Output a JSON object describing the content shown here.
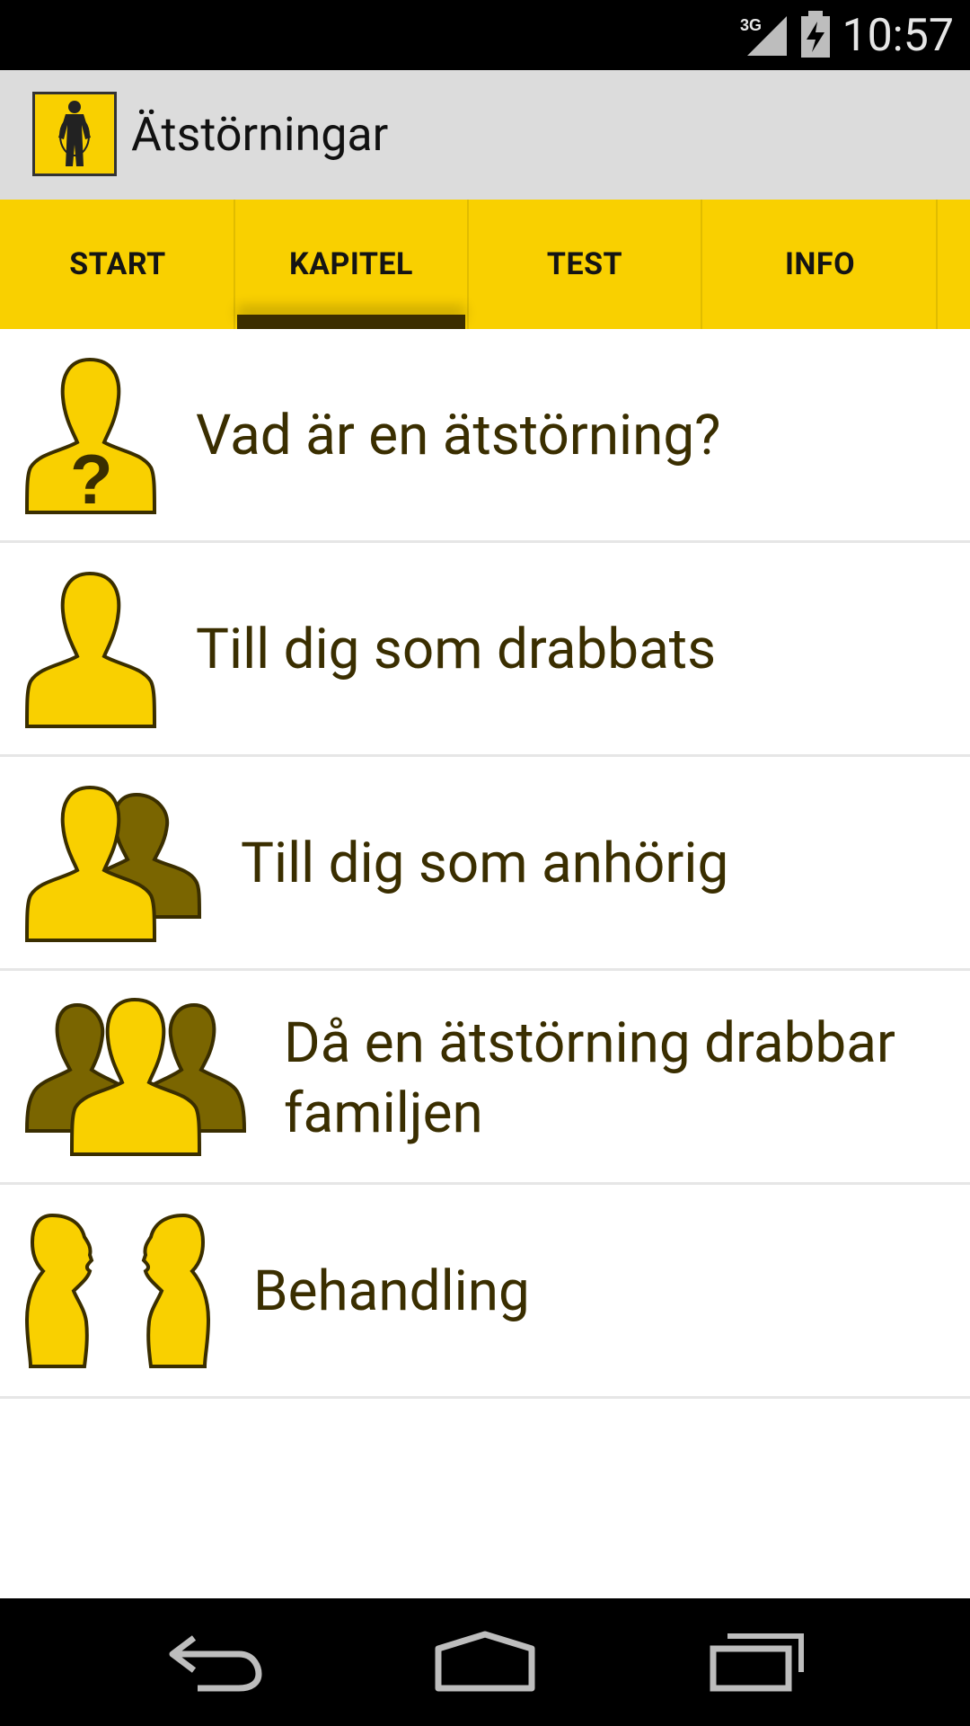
{
  "status": {
    "network": "3G",
    "time": "10:57"
  },
  "app": {
    "title": "Ätstörningar"
  },
  "tabs": [
    {
      "label": "START"
    },
    {
      "label": "KAPITEL",
      "selected": true
    },
    {
      "label": "TEST"
    },
    {
      "label": "INFO"
    }
  ],
  "chapters": [
    {
      "label": "Vad är en ätstörning?",
      "icon": "person-question-icon"
    },
    {
      "label": "Till dig som drabbats",
      "icon": "person-icon"
    },
    {
      "label": "Till dig som anhörig",
      "icon": "two-persons-icon"
    },
    {
      "label": "Då en ätstörning drabbar familjen",
      "icon": "family-icon"
    },
    {
      "label": "Behandling",
      "icon": "two-profiles-icon"
    }
  ],
  "colors": {
    "accent": "#f9d000",
    "dark_accent": "#7a6500",
    "text": "#3a2e00"
  }
}
